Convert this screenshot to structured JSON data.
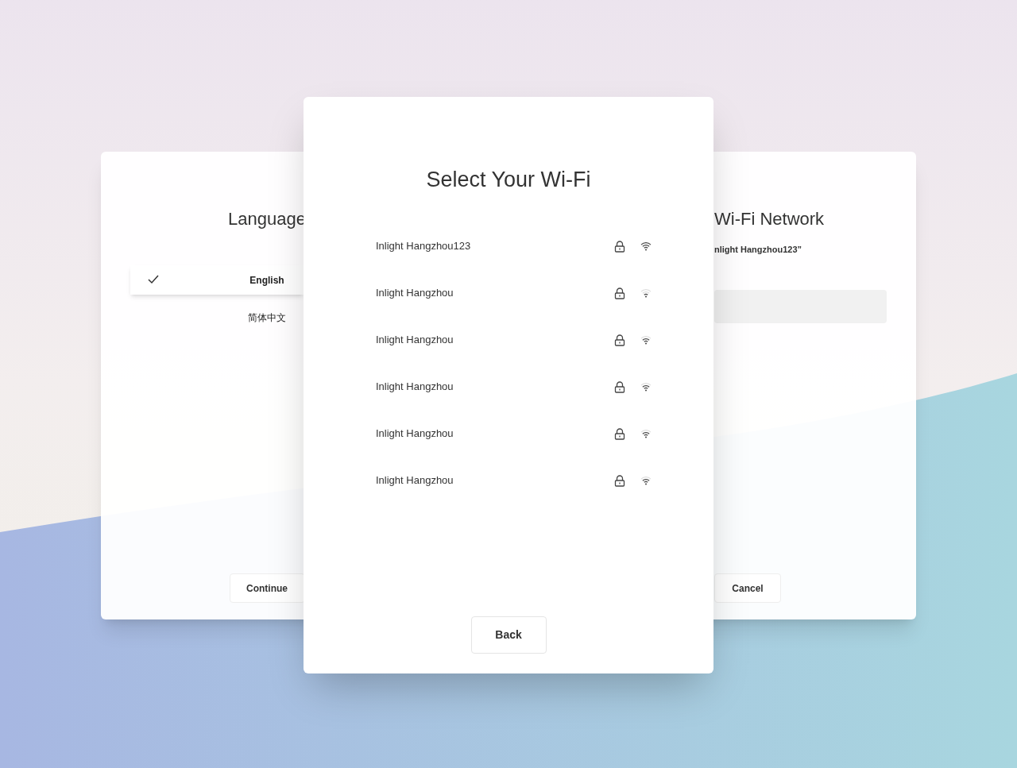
{
  "language_card": {
    "title": "Language",
    "options": [
      {
        "label": "English",
        "selected": true
      },
      {
        "label": "简体中文",
        "selected": false
      }
    ],
    "continue_button": "Continue"
  },
  "wifi_card": {
    "title": "Select Your Wi-Fi",
    "networks": [
      {
        "name": "Inlight Hangzhou123",
        "locked": true,
        "signal_strong": true,
        "signal_weak": false
      },
      {
        "name": "Inlight Hangzhou",
        "locked": true,
        "signal_strong": false,
        "signal_weak": true
      },
      {
        "name": "Inlight Hangzhou",
        "locked": true,
        "signal_strong": false,
        "signal_weak": false
      },
      {
        "name": "Inlight Hangzhou",
        "locked": true,
        "signal_strong": false,
        "signal_weak": false
      },
      {
        "name": "Inlight Hangzhou",
        "locked": true,
        "signal_strong": false,
        "signal_weak": false
      },
      {
        "name": "Inlight Hangzhou",
        "locked": true,
        "signal_strong": false,
        "signal_weak": false
      }
    ],
    "back_button": "Back"
  },
  "join_card": {
    "title": "Wi-Fi Network",
    "subtitle": "nlight Hangzhou123”",
    "cancel_button": "Cancel"
  }
}
